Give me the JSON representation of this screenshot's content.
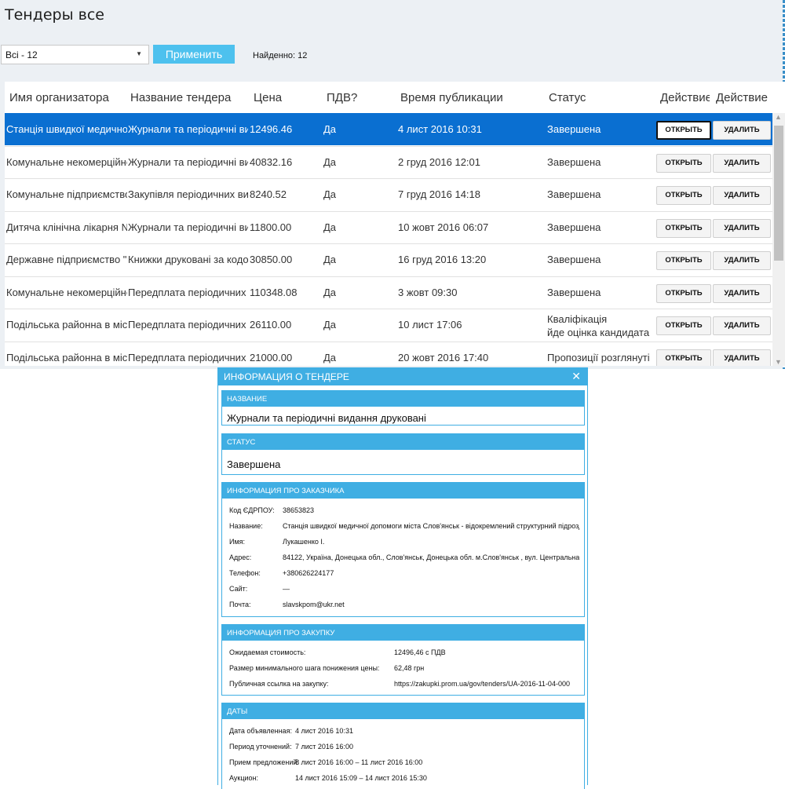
{
  "page": {
    "title": "Тендеры все"
  },
  "filter": {
    "selected": "Всі - 12",
    "apply_label": "Применить",
    "found_text": "Найденно: 12"
  },
  "table": {
    "columns": [
      "Имя организатора",
      "Название тендера",
      "Цена",
      "ПДВ?",
      "Время публикации",
      "Статус",
      "Действие",
      "Действие"
    ],
    "open_label": "ОТКРЫТЬ",
    "delete_label": "УДАЛИТЬ",
    "rows": [
      {
        "org": "Станція швидкої медичної допомоги",
        "name": "Журнали та періодичні видання",
        "price": "12496.46",
        "vat": "Да",
        "time": "4 лист 2016 10:31",
        "status": "Завершена",
        "status2": ""
      },
      {
        "org": "Комунальне некомерційне",
        "name": "Журнали та періодичні видання",
        "price": "40832.16",
        "vat": "Да",
        "time": "2 груд 2016 12:01",
        "status": "Завершена",
        "status2": ""
      },
      {
        "org": "Комунальне підприємство",
        "name": "Закупівля періодичних видань",
        "price": "8240.52",
        "vat": "Да",
        "time": "7 груд 2016 14:18",
        "status": "Завершена",
        "status2": ""
      },
      {
        "org": "Дитяча клінічна лікарня №",
        "name": "Журнали та періодичні видання",
        "price": "11800.00",
        "vat": "Да",
        "time": "10 жовт 2016 06:07",
        "status": "Завершена",
        "status2": ""
      },
      {
        "org": "Державне підприємство \"",
        "name": "Книжки друковані за кодом",
        "price": "30850.00",
        "vat": "Да",
        "time": "16 груд 2016 13:20",
        "status": "Завершена",
        "status2": ""
      },
      {
        "org": "Комунальне некомерційне",
        "name": "Передплата періодичних видань",
        "price": "110348.08",
        "vat": "Да",
        "time": "3 жовт 09:30",
        "status": "Завершена",
        "status2": ""
      },
      {
        "org": "Подільська районна в місті",
        "name": "Передплата періодичних видань",
        "price": "26110.00",
        "vat": "Да",
        "time": "10 лист 17:06",
        "status": "Кваліфікація",
        "status2": "йде оцінка кандидата"
      },
      {
        "org": "Подільська районна в місті",
        "name": "Передплата періодичних видань",
        "price": "21000.00",
        "vat": "Да",
        "time": "20 жовт 2016 17:40",
        "status": "Пропозиції розглянуті",
        "status2": ""
      }
    ]
  },
  "dialog": {
    "title": "ИНФОРМАЦИЯ О ТЕНДЕРЕ",
    "close": "✕",
    "name_head": "НАЗВАНИЕ",
    "name_value": "Журнали та періодичні видання друковані",
    "status_head": "СТАТУС",
    "status_value": "Завершена",
    "customer_head": "ИНФОРМАЦИЯ ПРО ЗАКАЗЧИКА",
    "customer": [
      {
        "k": "Код ЄДРПОУ:",
        "v": "38653823"
      },
      {
        "k": "Название:",
        "v": "Станція швидкої медичної допомоги міста Слов'янськ - відокремлений структурний підрозділ"
      },
      {
        "k": "Имя:",
        "v": "Лукашенко І."
      },
      {
        "k": "Адрес:",
        "v": "84122, Україна, Донецька обл., Слов'янськ, Донецька обл. м.Слов'янськ , вул. Центральна"
      },
      {
        "k": "Телефон:",
        "v": "+380626224177"
      },
      {
        "k": "Сайт:",
        "v": "—"
      },
      {
        "k": "Почта:",
        "v": "slavskpom@ukr.net"
      }
    ],
    "purchase_head": "ИНФОРМАЦИЯ ПРО ЗАКУПКУ",
    "purchase": [
      {
        "k": "Ожидаемая стоимость:",
        "v": "12496,46 с ПДВ"
      },
      {
        "k": "Размер минимального шага понижения цены:",
        "v": "62,48 грн"
      },
      {
        "k": "Публичная ссылка на закупку:",
        "v": "https://zakupki.prom.ua/gov/tenders/UA-2016-11-04-000"
      }
    ],
    "dates_head": "ДАТЫ",
    "dates": [
      {
        "k": "Дата объявленная:",
        "v": "4 лист 2016 10:31"
      },
      {
        "k": "Период уточнений:",
        "v": "7 лист 2016 16:00"
      },
      {
        "k": "Прием предложений:",
        "v": "8 лист 2016 16:00 – 11 лист 2016 16:00"
      },
      {
        "k": "Аукцион:",
        "v": "14 лист 2016 15:09 – 14 лист 2016 15:30"
      }
    ]
  },
  "colors": {
    "accent": "#3faee3",
    "selected_row": "#0a6fd1",
    "apply_button": "#4dc1ee"
  }
}
